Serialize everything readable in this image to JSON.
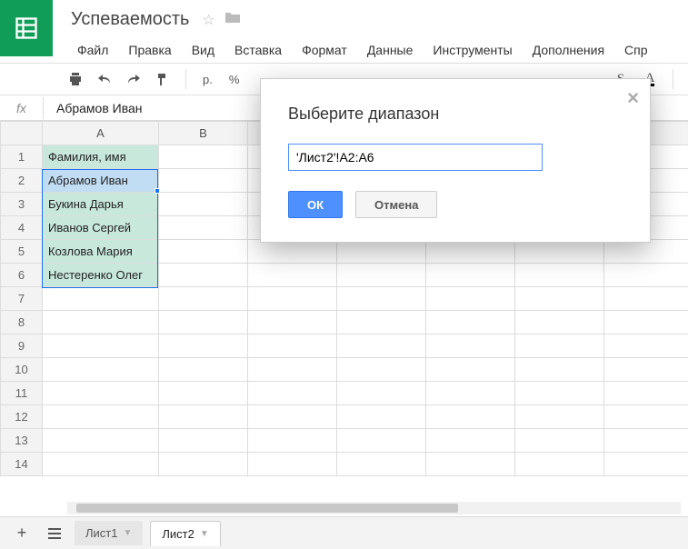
{
  "doc": {
    "title": "Успеваемость"
  },
  "menu": {
    "file": "Файл",
    "edit": "Правка",
    "view": "Вид",
    "insert": "Вставка",
    "format": "Формат",
    "data": "Данные",
    "tools": "Инструменты",
    "addons": "Дополнения",
    "help": "Спр"
  },
  "toolbar": {
    "currency": "р.",
    "percent": "%"
  },
  "formula": {
    "label": "fx",
    "value": "Абрамов Иван"
  },
  "columns": {
    "A": "A",
    "B": "B"
  },
  "rows": [
    "1",
    "2",
    "3",
    "4",
    "5",
    "6",
    "7",
    "8",
    "9",
    "10",
    "11",
    "12",
    "13",
    "14"
  ],
  "cells": {
    "A1": "Фамилия, имя",
    "A2": "Абрамов Иван",
    "A3": "Букина Дарья",
    "A4": "Иванов Сергей",
    "A5": "Козлова Мария",
    "A6": "Нестеренко Олег"
  },
  "dialog": {
    "title": "Выберите диапазон",
    "value": "'Лист2'!A2:A6",
    "ok": "ОК",
    "cancel": "Отмена"
  },
  "sheets": {
    "sheet1": "Лист1",
    "sheet2": "Лист2"
  }
}
